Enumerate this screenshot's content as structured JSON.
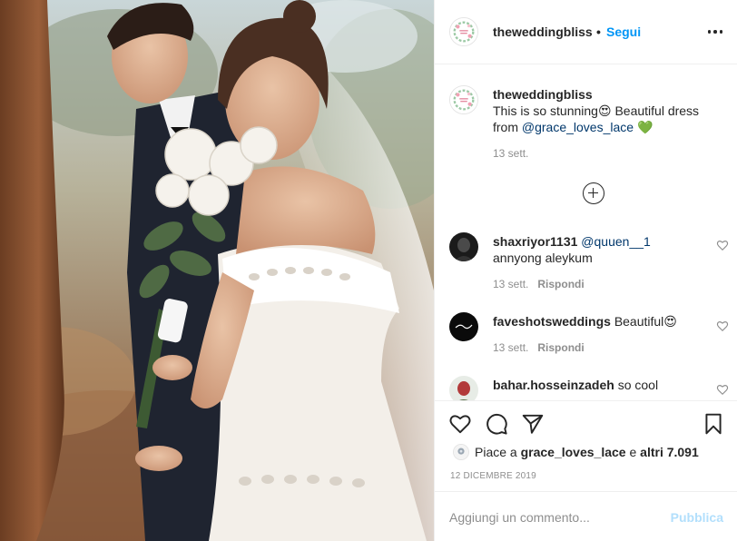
{
  "post": {
    "author": {
      "username": "theweddingbliss",
      "avatar_icon": "floral-wreath-logo"
    },
    "header": {
      "separator": "•",
      "follow_label": "Segui",
      "more_icon": "more-horizontal-icon"
    },
    "caption": {
      "username": "theweddingbliss",
      "text_before": "This is so stunning",
      "emoji_1": "😍",
      "text_middle": " Beautiful dress from ",
      "mention": "@grace_loves_lace",
      "emoji_2": "💚",
      "time": "13 sett."
    },
    "load_more_icon": "plus-circle-icon",
    "comments": [
      {
        "username": "shaxriyor1131",
        "mention": "@quuen__1",
        "text": "annyong aleykum",
        "time": "13 sett.",
        "reply_label": "Rispondi"
      },
      {
        "username": "faveshotsweddings",
        "mention": "",
        "text": "Beautiful😍",
        "time": "13 sett.",
        "reply_label": "Rispondi"
      },
      {
        "username": "bahar.hosseinzadeh",
        "mention": "",
        "text": "so cool",
        "time": "",
        "reply_label": ""
      }
    ],
    "actions": {
      "like_icon": "heart-icon",
      "comment_icon": "comment-icon",
      "share_icon": "paper-plane-icon",
      "save_icon": "bookmark-icon"
    },
    "likes": {
      "prefix": "Piace a ",
      "user": "grace_loves_lace",
      "connector": " e ",
      "others": "altri 7.091"
    },
    "date": "12 DICEMBRE 2019",
    "add_comment": {
      "placeholder": "Aggiungi un commento...",
      "publish_label": "Pubblica"
    },
    "colors": {
      "link": "#0095f6",
      "publish_disabled": "#b2dffc",
      "muted": "#8e8e8e",
      "text": "#262626",
      "mention": "#00376b"
    }
  }
}
